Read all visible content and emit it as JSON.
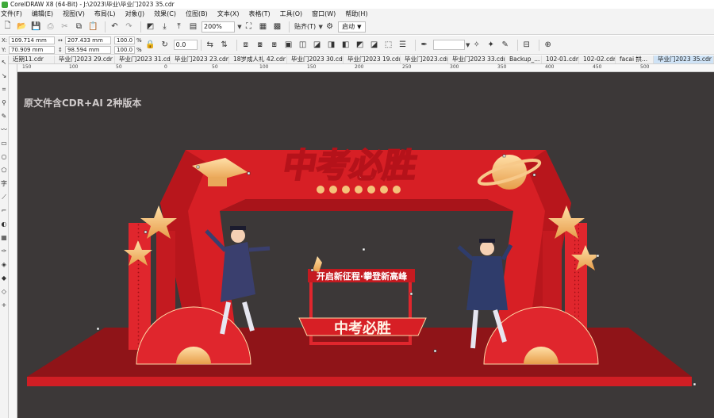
{
  "window": {
    "title": "CorelDRAW X8 (64-Bit) - J:\\2023\\毕业\\毕业门2023 35.cdr"
  },
  "menu": [
    "文件(F)",
    "编辑(E)",
    "视图(V)",
    "布局(L)",
    "对象(J)",
    "效果(C)",
    "位图(B)",
    "文本(X)",
    "表格(T)",
    "工具(O)",
    "窗口(W)",
    "帮助(H)"
  ],
  "toolbar": {
    "zoom": "200%",
    "snap_label": "贴齐(T)",
    "launch_label": "启动"
  },
  "properties": {
    "x_label": "X:",
    "y_label": "Y:",
    "x": "109.714 mm",
    "y": "70.909 mm",
    "width": "207.433 mm",
    "height": "98.594 mm",
    "scale_w": "100.0",
    "scale_h": "100.0",
    "pct": "%",
    "angle": "0.0"
  },
  "tabs": [
    "近期11.cdr",
    "毕业门2023 29.cdr",
    "毕业门2023 31.cdr",
    "毕业门2023 23.cdr",
    "18岁成人礼 42.cdr",
    "毕业门2023 30.cdr",
    "毕业门2023 19.cdr",
    "毕业门2023.cdr",
    "毕业门2023 33.cdr",
    "Backup_...",
    "102-01.cdr",
    "102-02.cdr",
    "facai 拱...",
    "毕业门2023 35.cdr"
  ],
  "active_tab_index": 13,
  "ruler_ticks": [
    "150",
    "100",
    "50",
    "0",
    "50",
    "100",
    "150",
    "200",
    "250",
    "300",
    "350",
    "400",
    "450",
    "500"
  ],
  "canvas": {
    "watermark": "原文件含CDR+AI 2种版本",
    "arch_title": "中考必胜",
    "slogan": "开启新征程·攀登新高峰",
    "banner": "中考必胜"
  },
  "colors": {
    "canvas_bg": "#3c3838",
    "stage_red": "#c4161c",
    "arch_red": "#d71f25",
    "gold": "#f4c27a"
  }
}
